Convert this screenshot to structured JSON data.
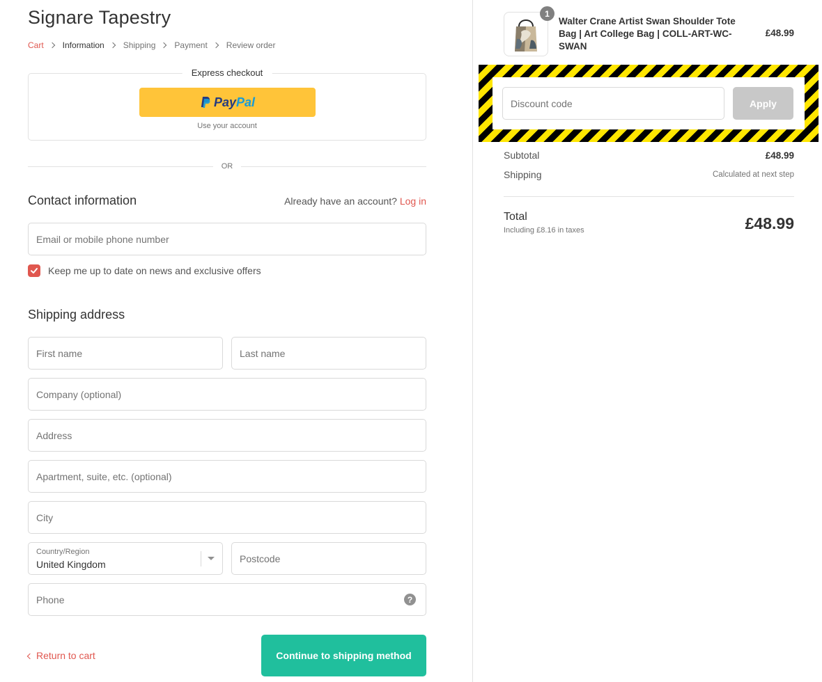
{
  "store": {
    "name": "Signare Tapestry"
  },
  "breadcrumb": {
    "items": [
      {
        "label": "Cart"
      },
      {
        "label": "Information"
      },
      {
        "label": "Shipping"
      },
      {
        "label": "Payment"
      },
      {
        "label": "Review order"
      }
    ]
  },
  "express": {
    "title": "Express checkout",
    "paypal_a": "Pay",
    "paypal_b": "Pal",
    "note": "Use your account"
  },
  "divider": {
    "text": "OR"
  },
  "contact": {
    "title": "Contact information",
    "account_prompt": "Already have an account?",
    "login_label": "Log in",
    "email_placeholder": "Email or mobile phone number",
    "newsletter_label": "Keep me up to date on news and exclusive offers",
    "newsletter_checked": true
  },
  "shipping": {
    "title": "Shipping address",
    "first_name_placeholder": "First name",
    "last_name_placeholder": "Last name",
    "company_placeholder": "Company (optional)",
    "address_placeholder": "Address",
    "apartment_placeholder": "Apartment, suite, etc. (optional)",
    "city_placeholder": "City",
    "country_label": "Country/Region",
    "country_value": "United Kingdom",
    "postcode_placeholder": "Postcode",
    "phone_placeholder": "Phone",
    "help_glyph": "?"
  },
  "actions": {
    "return_label": "Return to cart",
    "continue_label": "Continue to shipping method"
  },
  "order": {
    "product": {
      "name": "Walter Crane Artist Swan Shoulder Tote Bag | Art College Bag | COLL-ART-WC-SWAN",
      "price": "£48.99",
      "quantity": "1"
    },
    "discount_placeholder": "Discount code",
    "apply_label": "Apply",
    "subtotal_label": "Subtotal",
    "subtotal_value": "£48.99",
    "shipping_label": "Shipping",
    "shipping_value": "Calculated at next step",
    "total_label": "Total",
    "tax_note": "Including £8.16 in taxes",
    "total_value": "£48.99"
  },
  "colors": {
    "accent": "#e0574f",
    "primary_button": "#20bf9d",
    "paypal_yellow": "#ffc439",
    "hazard_yellow": "#ffe600",
    "hazard_black": "#000000"
  }
}
